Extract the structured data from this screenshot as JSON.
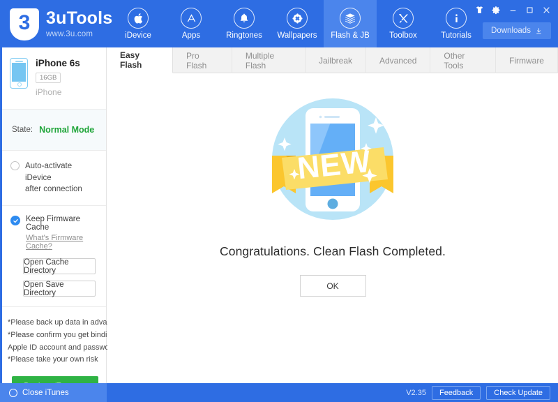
{
  "brand": {
    "name": "3uTools",
    "url": "www.3u.com",
    "logo_glyph": "3"
  },
  "nav": {
    "items": [
      {
        "label": "iDevice",
        "icon": "apple-icon",
        "active": false
      },
      {
        "label": "Apps",
        "icon": "appstore-icon",
        "active": false
      },
      {
        "label": "Ringtones",
        "icon": "bell-icon",
        "active": false
      },
      {
        "label": "Wallpapers",
        "icon": "flower-icon",
        "active": false
      },
      {
        "label": "Flash & JB",
        "icon": "openbox-icon",
        "active": true
      },
      {
        "label": "Toolbox",
        "icon": "tools-icon",
        "active": false
      },
      {
        "label": "Tutorials",
        "icon": "info-icon",
        "active": false
      }
    ]
  },
  "window_controls": {
    "skin": "tshirt-icon",
    "settings": "gear-icon",
    "minimize": "minimize-icon",
    "maximize": "maximize-icon",
    "close": "close-icon"
  },
  "downloads": {
    "label": "Downloads",
    "icon": "download-icon"
  },
  "tabs": [
    {
      "label": "Easy Flash",
      "active": true
    },
    {
      "label": "Pro Flash",
      "active": false
    },
    {
      "label": "Multiple Flash",
      "active": false
    },
    {
      "label": "Jailbreak",
      "active": false
    },
    {
      "label": "Advanced",
      "active": false
    },
    {
      "label": "Other Tools",
      "active": false
    },
    {
      "label": "Firmware",
      "active": false
    }
  ],
  "sidebar": {
    "device": {
      "name": "iPhone 6s",
      "capacity": "16GB",
      "type": "iPhone"
    },
    "state": {
      "key": "State:",
      "value": "Normal Mode",
      "value_color": "#20a53a"
    },
    "auto_activate": {
      "line1": "Auto-activate iDevice",
      "line2": "after connection",
      "checked": false
    },
    "firmware_cache": {
      "label": "Keep Firmware Cache",
      "link": "What's Firmware Cache?",
      "checked": true,
      "buttons": [
        {
          "label": "Open Cache Directory"
        },
        {
          "label": "Open Save Directory"
        }
      ]
    },
    "warnings": [
      "*Please back up data in advance",
      "*Please confirm you get binding",
      " Apple ID account and password",
      "*Please take your own risk"
    ],
    "backup_button": {
      "label": "Back up/Restore",
      "color": "#2fb344"
    }
  },
  "main": {
    "illustration": {
      "name": "new-phone-badge-illustration",
      "ribbon_text": "NEW",
      "circle_color": "#b9e4f7",
      "phone_screen_color": "#6cb4f8",
      "ribbon_color": "#fbdd67",
      "ribbon_tail_color": "#fbc62e"
    },
    "message": "Congratulations. Clean Flash Completed.",
    "ok_button": "OK"
  },
  "statusbar": {
    "close_itunes": {
      "label": "Close iTunes",
      "checked": false
    },
    "version": "V2.35",
    "feedback": "Feedback",
    "check_update": "Check Update"
  },
  "theme": {
    "header_blue": "#2e6de3",
    "header_blue_light": "#4b85ec",
    "green": "#20a53a",
    "tab_bg": "#f2f2f2"
  }
}
